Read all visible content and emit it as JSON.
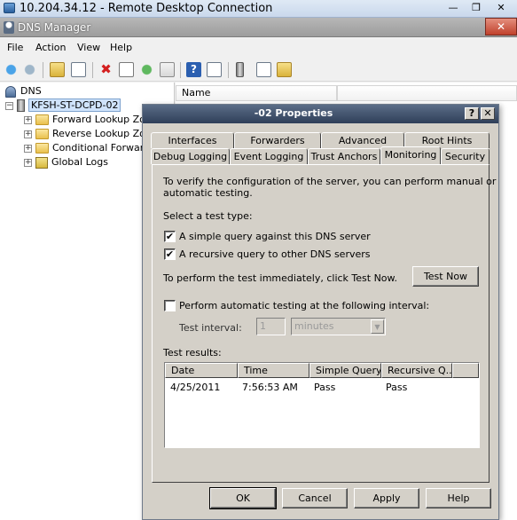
{
  "rdp": {
    "title": "10.204.34.12 - Remote Desktop Connection",
    "minimize": "—",
    "restore": "❒",
    "close": "✕"
  },
  "window": {
    "title": "DNS Manager",
    "close": "✕"
  },
  "menu": [
    "File",
    "Action",
    "View",
    "Help"
  ],
  "toolbar": {
    "icons": [
      "back-arrow-icon",
      "forward-arrow-icon",
      "up-folder-icon",
      "show-hide-tree-icon",
      "delete-icon",
      "properties-icon",
      "refresh-icon",
      "export-icon",
      "help-icon",
      "console-tree-icon",
      "server-icon",
      "list-icon",
      "folder-icon"
    ]
  },
  "tree": {
    "root": "DNS",
    "server": "KFSH-ST-DCPD-02",
    "children": [
      "Forward Lookup Zon",
      "Reverse Lookup Zon",
      "Conditional Forward",
      "Global Logs"
    ]
  },
  "listpane": {
    "column_name": "Name"
  },
  "dialog": {
    "title": "-02 Properties",
    "help_btn": "?",
    "close_btn": "✕",
    "tabs_row1": [
      "Interfaces",
      "Forwarders",
      "Advanced",
      "Root Hints"
    ],
    "tabs_row2": [
      "Debug Logging",
      "Event Logging",
      "Trust Anchors",
      "Monitoring",
      "Security"
    ],
    "active_tab": "Monitoring",
    "intro_line1": "To verify the configuration of the server, you can perform manual or",
    "intro_line2": "automatic testing.",
    "select_test_label": "Select a test type:",
    "simple_query_label": "A simple query against this DNS server",
    "simple_query_checked": true,
    "recursive_query_label": "A recursive query to other DNS servers",
    "recursive_query_checked": true,
    "test_now_prompt": "To perform the test immediately, click Test Now.",
    "test_now_button": "Test Now",
    "auto_test_label": "Perform automatic testing at the following interval:",
    "auto_test_checked": false,
    "interval_label": "Test interval:",
    "interval_value": "1",
    "interval_unit": "minutes",
    "results_label": "Test results:",
    "results_columns": [
      "Date",
      "Time",
      "Simple Query",
      "Recursive Q..."
    ],
    "results_rows": [
      [
        "4/25/2011",
        "7:56:53 AM",
        "Pass",
        "Pass"
      ]
    ],
    "ok_button": "OK",
    "cancel_button": "Cancel",
    "apply_button": "Apply",
    "help_button": "Help",
    "check_mark": "✔"
  }
}
